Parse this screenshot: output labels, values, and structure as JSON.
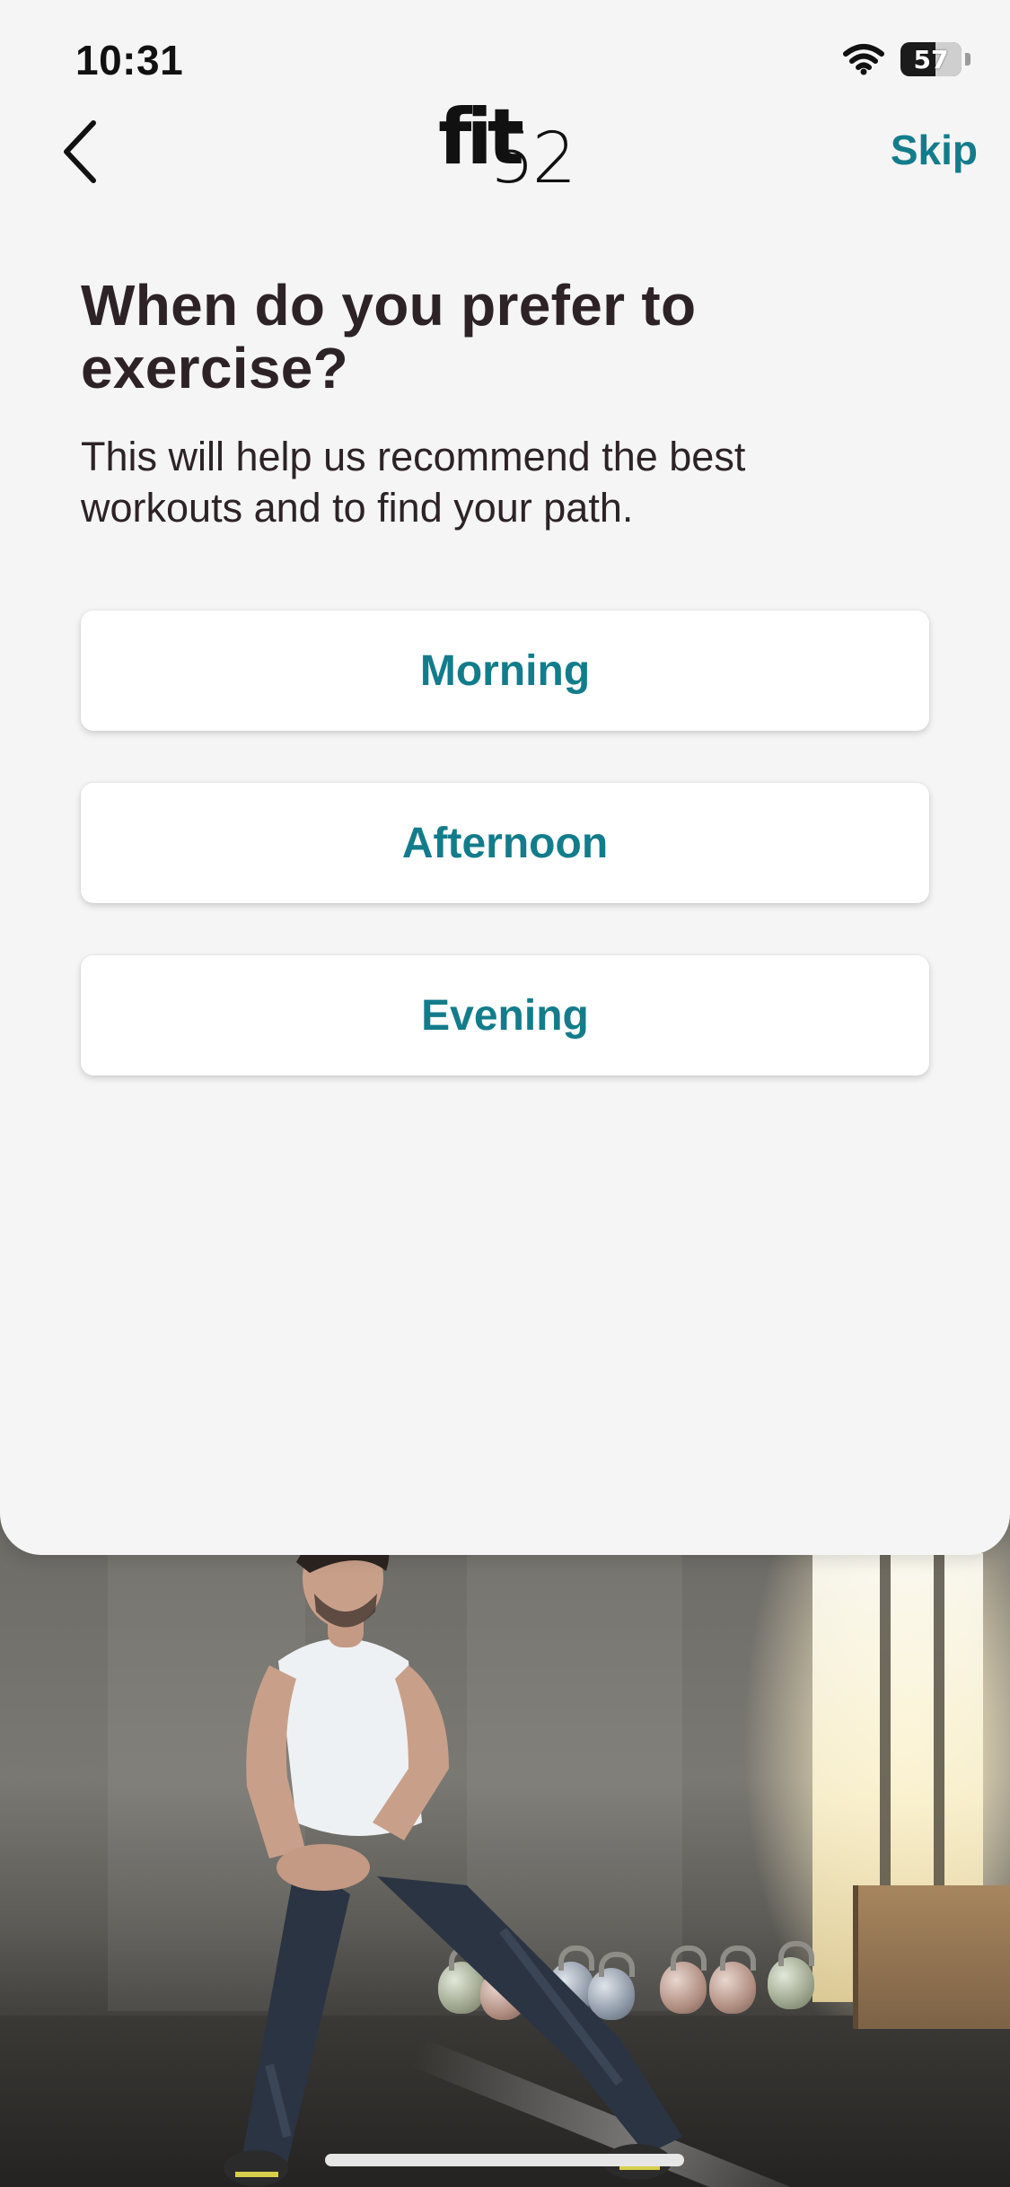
{
  "status_bar": {
    "time": "10:31",
    "battery_percent": "57",
    "icons": [
      "wifi-icon",
      "battery-icon"
    ]
  },
  "nav": {
    "back_icon": "chevron-left-icon",
    "logo_text_main": "fit",
    "logo_text_number": "52",
    "skip_label": "Skip"
  },
  "content": {
    "title": "When do you prefer to exercise?",
    "subtitle": "This will help us recommend the best workouts and to find your path."
  },
  "options": [
    {
      "label": "Morning"
    },
    {
      "label": "Afternoon"
    },
    {
      "label": "Evening"
    }
  ],
  "colors": {
    "accent": "#137c8b",
    "text_dark": "#2d2327",
    "background": "#f5f5f5",
    "card": "#ffffff"
  }
}
